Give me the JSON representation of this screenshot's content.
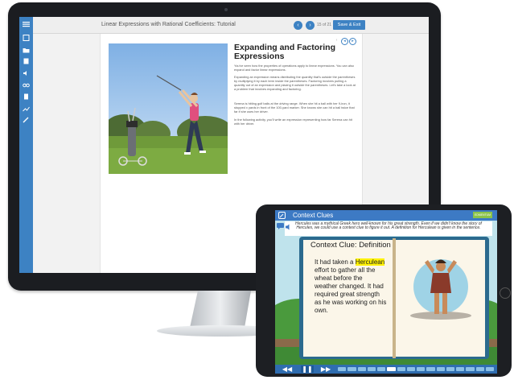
{
  "monitor_app": {
    "lesson_title": "Linear Expressions with Rational Coefficients: Tutorial",
    "page_count": "15 of 21",
    "save_exit_label": "Save & Exit",
    "section_heading": "Expanding and Factoring Expressions",
    "paragraphs": [
      "You've seen how the properties of operations apply to linear expressions. You can also expand and factor linear expressions.",
      "Expanding an expression means distributing the quantity that's outside the parentheses by multiplying it by each term inside the parentheses. Factoring involves pulling a quantity out of an expression and placing it outside the parentheses. Let's take a look at a problem that involves expanding and factoring.",
      "Serena is hitting golf balls at the driving range. When she hit a ball with her 9-iron, it stopped x yards in front of the 100-yard marker. She knows she can hit a ball twice that far if she uses her driver.",
      "In the following activity, you'll write an expression representing how far Serena can hit with her driver."
    ],
    "nav_prev_icon": "‹",
    "nav_next_icon": "›",
    "sidebar_icons": [
      "menu-icon",
      "book-icon",
      "folder-icon",
      "notebook-icon",
      "audio-icon",
      "glasses-icon",
      "calculator-icon",
      "chart-icon",
      "pen-icon"
    ],
    "accent": "#3d82c3"
  },
  "tablet_app": {
    "title": "Context Clues",
    "badge": "EDMENTUM",
    "instruction_parts": [
      "Hercules",
      " was a mythical Greek hero well-known for his great strength. Even if we didn't know the story of ",
      "Hercules",
      ", we could use a context clue to figure it out. A definition for ",
      "Herculean",
      " is given in the sentence."
    ],
    "card_title": "Context Clue: Definition",
    "card_text_before": "It had taken a ",
    "card_highlight": "Herculean",
    "card_text_after": " effort to gather all the wheat before the weather changed. It had required great strength as he was working on his own.",
    "controls": {
      "rewind": "◀◀",
      "pause": "❚❚",
      "forward": "▶▶"
    },
    "progress_segments": 16,
    "progress_current": 5,
    "accent": "#3d7ac4"
  }
}
